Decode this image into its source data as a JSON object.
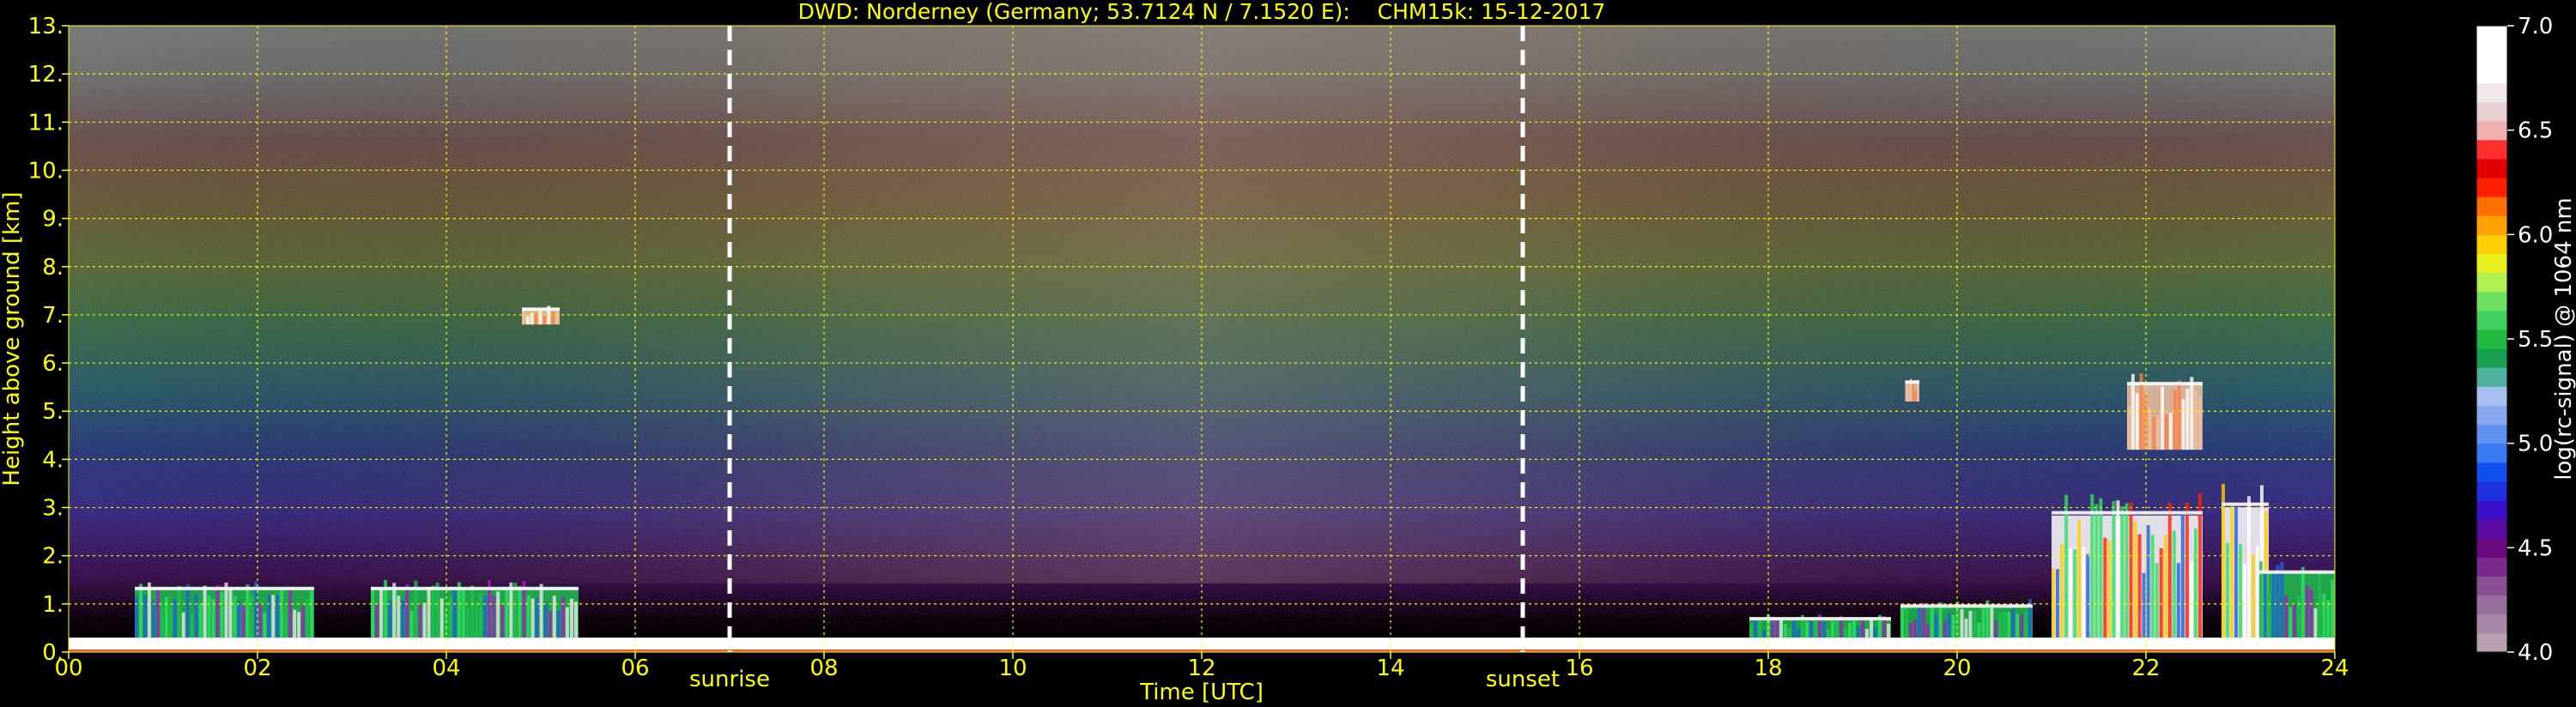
{
  "chart_data": {
    "type": "heatmap",
    "title": "DWD: Norderney (Germany; 53.7124 N / 7.1520 E):    CHM15k: 15-12-2017",
    "xlabel": "Time [UTC]",
    "ylabel": "Height above ground [km]",
    "xlim": [
      0,
      24
    ],
    "ylim": [
      0,
      13
    ],
    "x_ticks": [
      0,
      2,
      4,
      6,
      8,
      10,
      12,
      14,
      16,
      18,
      20,
      22,
      24
    ],
    "x_tick_labels": [
      "00",
      "02",
      "04",
      "06",
      "08",
      "10",
      "12",
      "14",
      "16",
      "18",
      "20",
      "22",
      "24"
    ],
    "y_ticks": [
      0,
      1,
      2,
      3,
      4,
      5,
      6,
      7,
      8,
      9,
      10,
      11,
      12,
      13
    ],
    "y_tick_labels": [
      "0.",
      "1.",
      "2.",
      "3.",
      "4.",
      "5.",
      "6.",
      "7.",
      "8.",
      "9.",
      "10.",
      "11.",
      "12.",
      "13."
    ],
    "grid": true,
    "grid_color": "#ffff00",
    "background": "#000000",
    "annotations": [
      {
        "label": "sunrise",
        "x": 7.0
      },
      {
        "label": "sunset",
        "x": 15.4
      }
    ],
    "colorbar": {
      "label": "log(rc-signal) @ 1064 nm",
      "range": [
        4.0,
        7.0
      ],
      "ticks": [
        4.0,
        4.5,
        5.0,
        5.5,
        6.0,
        6.5,
        7.0
      ],
      "tick_labels": [
        "4.0",
        "4.5",
        "5.0",
        "5.5",
        "6.0",
        "6.5",
        "7.0"
      ],
      "colors": [
        "#b8a0b0",
        "#a888a8",
        "#9870a0",
        "#8a5096",
        "#7a2a8c",
        "#6a0a80",
        "#5a0aa0",
        "#3a10c8",
        "#2030e0",
        "#1050f0",
        "#3878f0",
        "#6090f0",
        "#88a8f0",
        "#a8c0f0",
        "#50b0a0",
        "#18a050",
        "#20b840",
        "#40d060",
        "#70e060",
        "#b0f050",
        "#e8f020",
        "#ffd000",
        "#ffa000",
        "#ff7000",
        "#ff2000",
        "#e00000",
        "#ff3030",
        "#f0b0b0",
        "#e8d0d0",
        "#f0e8e8",
        "#ffffff",
        "#ffffff",
        "#ffffff"
      ]
    },
    "features": [
      {
        "kind": "low cloud band",
        "t_start": 0.7,
        "t_end": 2.6,
        "base_km": 0.3,
        "top_km": 1.5
      },
      {
        "kind": "low cloud band",
        "t_start": 3.2,
        "t_end": 5.4,
        "base_km": 0.3,
        "top_km": 1.5
      },
      {
        "kind": "cloud patch",
        "t_start": 4.8,
        "t_end": 5.2,
        "base_km": 6.8,
        "top_km": 7.2
      },
      {
        "kind": "low cloud band",
        "t_start": 17.8,
        "t_end": 19.3,
        "base_km": 0.2,
        "top_km": 0.8
      },
      {
        "kind": "low cloud band",
        "t_start": 19.4,
        "t_end": 20.8,
        "base_km": 0.2,
        "top_km": 1.1
      },
      {
        "kind": "cloud patch",
        "t_start": 19.45,
        "t_end": 19.6,
        "base_km": 5.2,
        "top_km": 5.7
      },
      {
        "kind": "convective cloud",
        "t_start": 21.0,
        "t_end": 22.6,
        "base_km": 0.2,
        "top_km": 3.3
      },
      {
        "kind": "cloud patch",
        "t_start": 21.8,
        "t_end": 22.6,
        "base_km": 4.2,
        "top_km": 5.8
      },
      {
        "kind": "convective cloud",
        "t_start": 22.8,
        "t_end": 23.3,
        "base_km": 0.2,
        "top_km": 3.5
      },
      {
        "kind": "low cloud band",
        "t_start": 23.2,
        "t_end": 24.0,
        "base_km": 0.2,
        "top_km": 1.9
      },
      {
        "kind": "surface layer",
        "t_start": 0.0,
        "t_end": 24.0,
        "base_km": 0.0,
        "top_km": 0.3
      }
    ]
  }
}
